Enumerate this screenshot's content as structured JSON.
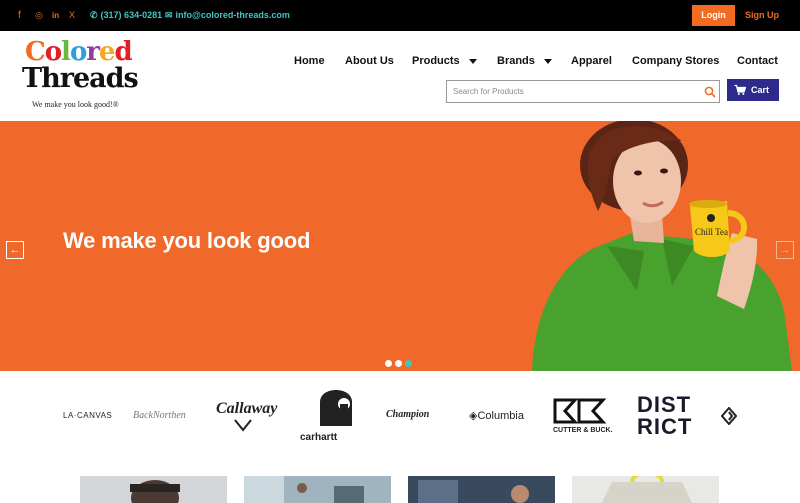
{
  "topbar": {
    "social_icons": [
      "facebook-icon",
      "instagram-icon",
      "linkedin-icon",
      "x-icon"
    ],
    "social_glyphs": [
      "f",
      "◎",
      "in",
      "X"
    ],
    "phone": "(317) 634-0281",
    "email": "info@colored-threads.com",
    "login_label": "Login",
    "signup_label": "Sign Up"
  },
  "logo": {
    "line1_letters": [
      "C",
      "o",
      "l",
      "o",
      "r",
      "e",
      "d"
    ],
    "line1_colors": [
      "#f26b21",
      "#e31e24",
      "#6bb744",
      "#2d9fd8",
      "#8d3f97",
      "#f7a823",
      "#e31e24"
    ],
    "line2": "Threads",
    "tagline": "We make you look good!®"
  },
  "nav": {
    "items": [
      {
        "label": "Home",
        "dropdown": false
      },
      {
        "label": "About Us",
        "dropdown": false
      },
      {
        "label": "Products",
        "dropdown": true
      },
      {
        "label": "Brands",
        "dropdown": true
      },
      {
        "label": "Apparel",
        "dropdown": false
      },
      {
        "label": "Company Stores",
        "dropdown": false
      },
      {
        "label": "Contact",
        "dropdown": false
      }
    ]
  },
  "search": {
    "placeholder": "Search for Products"
  },
  "cart": {
    "label": "Cart"
  },
  "hero": {
    "title": "We make you look good",
    "mug_text": "Chill Tea",
    "slides": 3,
    "active_slide": 3
  },
  "brands": [
    "LA·CANVAS",
    "BackNorthen",
    "Callaway",
    "carhartt",
    "Champion",
    "Columbia",
    "CUTTER & BUCK.",
    "DISTRICT"
  ],
  "colors": {
    "accent": "#f26b21",
    "teal": "#3ec6c0",
    "hero_bg": "#f0692a",
    "cart_bg": "#2d2a8c"
  }
}
